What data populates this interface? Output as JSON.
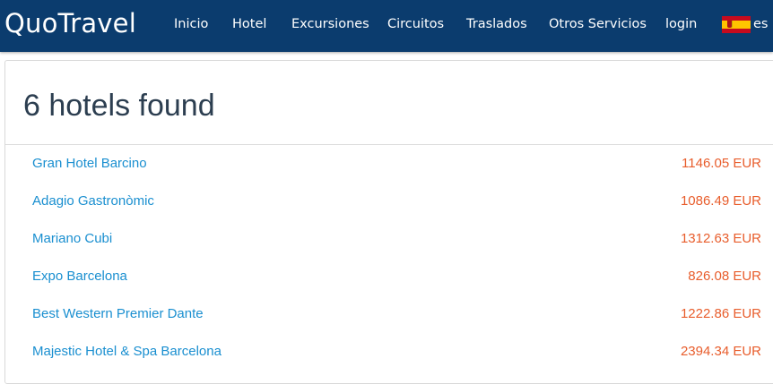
{
  "navbar": {
    "brand": "QuoTravel",
    "links": [
      {
        "label": "Inicio"
      },
      {
        "label": "Hotel"
      },
      {
        "label": "Excursiones"
      },
      {
        "label": "Circuitos"
      },
      {
        "label": "Traslados"
      },
      {
        "label": "Otros Servicios"
      },
      {
        "label": "login"
      }
    ],
    "language": {
      "code": "es",
      "flag": "spain-flag-icon"
    },
    "background": "#0b3c6e"
  },
  "results": {
    "title": "6 hotels found",
    "hotels": [
      {
        "name": "Gran Hotel Barcino",
        "price": "1146.05 EUR"
      },
      {
        "name": "Adagio Gastronòmic",
        "price": "1086.49 EUR"
      },
      {
        "name": "Mariano Cubi",
        "price": "1312.63 EUR"
      },
      {
        "name": "Expo Barcelona",
        "price": "826.08 EUR"
      },
      {
        "name": "Best Western Premier Dante",
        "price": "1222.86 EUR"
      },
      {
        "name": "Majestic Hotel & Spa Barcelona",
        "price": "2394.34 EUR"
      }
    ]
  },
  "colors": {
    "link": "#1a8fd0",
    "price": "#e85d2c",
    "title": "#2c3e50"
  }
}
